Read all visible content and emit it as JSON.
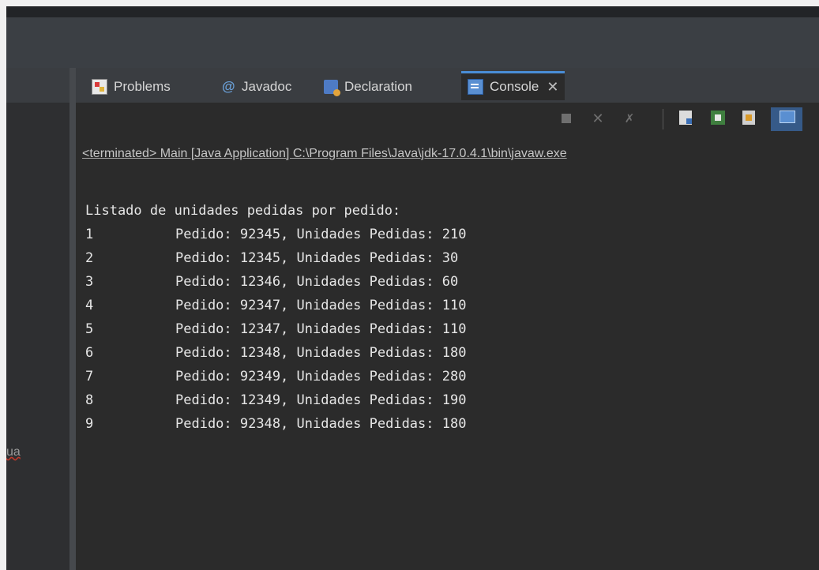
{
  "tabs": [
    {
      "label": "Problems",
      "icon": "problems-icon"
    },
    {
      "label": "Javadoc",
      "icon": "javadoc-icon"
    },
    {
      "label": "Declaration",
      "icon": "declaration-icon"
    },
    {
      "label": "Console",
      "icon": "console-icon",
      "active": true
    }
  ],
  "tab_close_glyph": "✕",
  "left_panel": {
    "fragment_text": "ua"
  },
  "console": {
    "status_line": "<terminated> Main [Java Application] C:\\Program Files\\Java\\jdk-17.0.4.1\\bin\\javaw.exe",
    "heading": "Listado de unidades pedidas por pedido:",
    "rows": [
      {
        "index": "1",
        "text": "Pedido: 92345, Unidades Pedidas: 210"
      },
      {
        "index": "2",
        "text": "Pedido: 12345, Unidades Pedidas: 30"
      },
      {
        "index": "3",
        "text": "Pedido: 12346, Unidades Pedidas: 60"
      },
      {
        "index": "4",
        "text": "Pedido: 92347, Unidades Pedidas: 110"
      },
      {
        "index": "5",
        "text": "Pedido: 12347, Unidades Pedidas: 110"
      },
      {
        "index": "6",
        "text": "Pedido: 12348, Unidades Pedidas: 180"
      },
      {
        "index": "7",
        "text": "Pedido: 92349, Unidades Pedidas: 280"
      },
      {
        "index": "8",
        "text": "Pedido: 12349, Unidades Pedidas: 190"
      },
      {
        "index": "9",
        "text": "Pedido: 92348, Unidades Pedidas: 180"
      }
    ]
  },
  "colors": {
    "background": "#2b2b2b",
    "active_tab_accent": "#4a8dd6",
    "text": "#e6e6e6"
  }
}
